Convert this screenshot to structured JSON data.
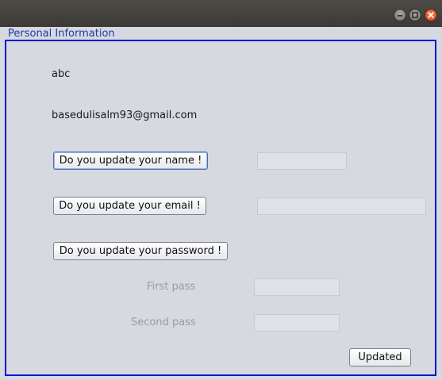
{
  "window": {
    "controls": [
      "minimize-icon",
      "maximize-icon",
      "close-icon"
    ]
  },
  "panel": {
    "title": "Personal Information"
  },
  "profile": {
    "name": "abc",
    "email": "basedulisalm93@gmail.com"
  },
  "buttons": {
    "update_name": "Do you update your name !",
    "update_email": "Do you update your email !",
    "update_password": "Do you update your password !",
    "updated": "Updated"
  },
  "fields": {
    "name_value": "",
    "email_value": "",
    "first_pass_value": "",
    "second_pass_value": ""
  },
  "labels": {
    "first_pass": "First pass",
    "second_pass": "Second pass"
  },
  "colors": {
    "border_accent": "#0a14d6",
    "title_accent": "#1c3aa8",
    "close_button": "#d44a1d"
  }
}
